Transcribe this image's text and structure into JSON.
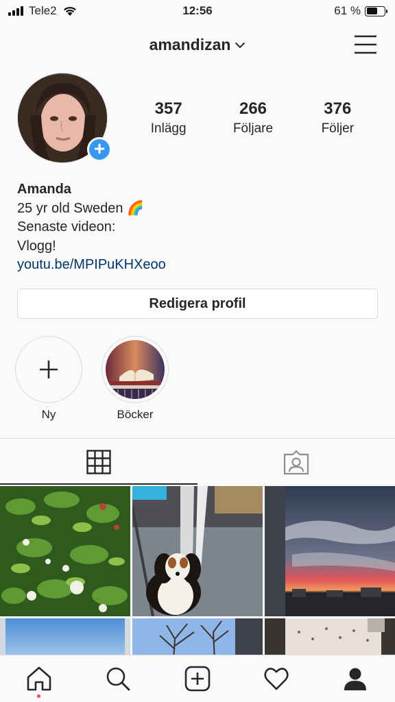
{
  "status_bar": {
    "carrier": "Tele2",
    "time": "12:56",
    "battery_text": "61 %",
    "battery_level": 0.61,
    "icons": [
      "signal-icon",
      "wifi-icon",
      "battery-icon"
    ]
  },
  "header": {
    "username": "amandizan",
    "icons": [
      "chevron-down-icon",
      "hamburger-menu-icon"
    ]
  },
  "stats": [
    {
      "value": "357",
      "label": "Inlägg"
    },
    {
      "value": "266",
      "label": "Följare"
    },
    {
      "value": "376",
      "label": "Följer"
    }
  ],
  "bio": {
    "name": "Amanda",
    "line1": "25 yr old Sweden 🌈",
    "line2": "Senaste videon:",
    "line3": "Vlogg!",
    "link": "youtu.be/MPIPuKHXeoo"
  },
  "edit_profile_label": "Redigera profil",
  "highlights": [
    {
      "label": "Ny",
      "icon": "plus-icon"
    },
    {
      "label": "Böcker",
      "icon": "books-image"
    }
  ],
  "tabs": [
    {
      "name": "grid",
      "icon": "grid-icon",
      "active": true
    },
    {
      "name": "tagged",
      "icon": "tagged-person-icon",
      "active": false
    }
  ],
  "bottom_nav": [
    "home-icon",
    "search-icon",
    "new-post-icon",
    "heart-icon",
    "profile-icon"
  ],
  "colors": {
    "accent": "#3897f0",
    "link": "#003569",
    "notification_dot": "#ed4956",
    "border": "#dbdbdb",
    "background": "#fafafa"
  }
}
